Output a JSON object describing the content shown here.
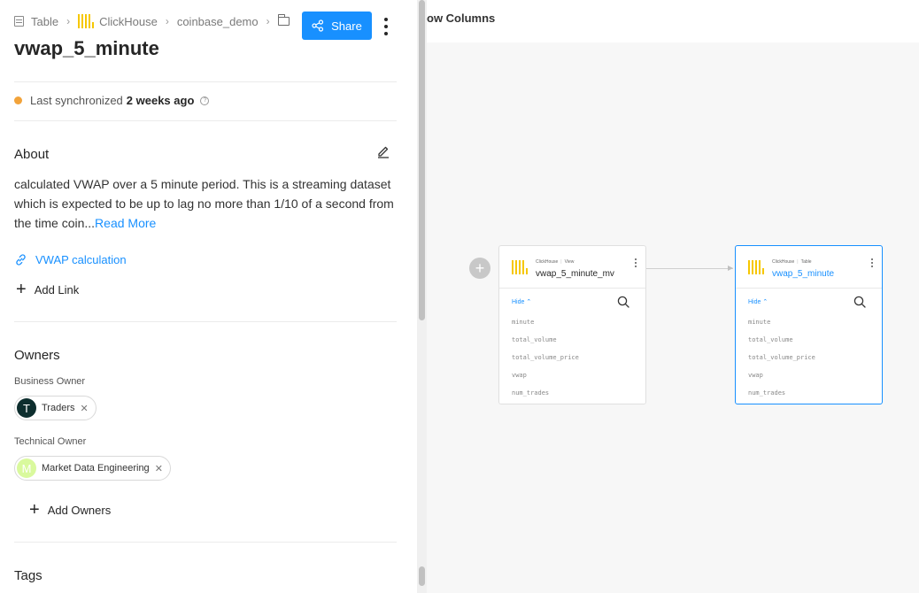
{
  "breadcrumb": {
    "entity_type": "Table",
    "platform": "ClickHouse",
    "database": "coinbase_demo"
  },
  "header": {
    "title": "vwap_5_minute",
    "share_label": "Share"
  },
  "sync": {
    "prefix": "Last synchronized",
    "value": "2 weeks ago",
    "status_color": "#f2a33a"
  },
  "about": {
    "heading": "About",
    "text": "calculated VWAP over a 5 minute period. This is a streaming dataset which is expected to be up to lag no more than 1/10 of a second from the time coin...",
    "read_more": "Read More",
    "link_label": "VWAP calculation",
    "add_link_label": "Add Link"
  },
  "owners": {
    "heading": "Owners",
    "business_label": "Business Owner",
    "business_owner": {
      "initial": "T",
      "name": "Traders",
      "avatar_color": "#0d2e2e"
    },
    "technical_label": "Technical Owner",
    "technical_owner": {
      "initial": "M",
      "name": "Market Data Engineering",
      "avatar_color": "#d9f99d"
    },
    "add_label": "Add Owners"
  },
  "tags": {
    "heading": "Tags"
  },
  "canvas": {
    "toolbar_text": "ow Columns",
    "nodes": [
      {
        "platform": "ClickHouse",
        "subtype": "View",
        "name": "vwap_5_minute_mv",
        "hide_label": "Hide",
        "columns": [
          "minute",
          "total_volume",
          "total_volume_price",
          "vwap",
          "num_trades"
        ]
      },
      {
        "platform": "ClickHouse",
        "subtype": "Table",
        "name": "vwap_5_minute",
        "hide_label": "Hide",
        "columns": [
          "minute",
          "total_volume",
          "total_volume_price",
          "vwap",
          "num_trades"
        ]
      }
    ]
  },
  "colors": {
    "accent": "#1890ff",
    "clickhouse_yellow": "#f6c700",
    "clickhouse_red": "#e02020"
  }
}
